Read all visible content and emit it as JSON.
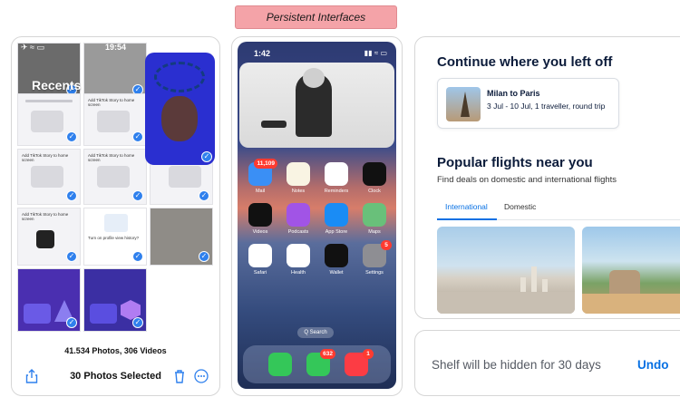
{
  "banner": {
    "title": "Persistent Interfaces"
  },
  "photos_panel": {
    "status": {
      "left": "✈ ≈ ▭",
      "time": "19:54",
      "right": "◉ 16% ▭"
    },
    "album_title": "Recents",
    "counts": "41.534 Photos, 306 Videos",
    "selected_label": "30 Photos Selected",
    "thumb_texts": {
      "add_tiktok": "Add TikTok Story to home screen",
      "profile_history": "Turn on profile view history?"
    }
  },
  "home_panel": {
    "time": "1:42",
    "status_right": "▮▮ ≈ ▭",
    "apps": [
      {
        "label": "Mail",
        "badge": "11,109",
        "color": "#3a8ff5"
      },
      {
        "label": "Notes",
        "badge": "",
        "color": "#f9f4e3"
      },
      {
        "label": "Reminders",
        "badge": "",
        "color": "#ffffff"
      },
      {
        "label": "Clock",
        "badge": "",
        "color": "#111111"
      },
      {
        "label": "Videos",
        "badge": "",
        "color": "#111111"
      },
      {
        "label": "Podcasts",
        "badge": "",
        "color": "#a154e6"
      },
      {
        "label": "App Store",
        "badge": "",
        "color": "#1a8cf5"
      },
      {
        "label": "Maps",
        "badge": "",
        "color": "#69c07a"
      },
      {
        "label": "Safari",
        "badge": "",
        "color": "#ffffff"
      },
      {
        "label": "Health",
        "badge": "",
        "color": "#ffffff"
      },
      {
        "label": "Wallet",
        "badge": "",
        "color": "#111111"
      },
      {
        "label": "Settings",
        "badge": "5",
        "color": "#8e8e93"
      }
    ],
    "search_label": "Q Search",
    "dock": [
      {
        "name": "phone",
        "badge": "",
        "color": "#34c759"
      },
      {
        "name": "messages",
        "badge": "632",
        "color": "#34c759"
      },
      {
        "name": "music",
        "badge": "1",
        "color": "#fc3c44"
      }
    ]
  },
  "flights_panel": {
    "continue_title": "Continue where you left off",
    "trip_title": "Milan to Paris",
    "trip_details": "3 Jul - 10 Jul, 1 traveller, round trip",
    "popular_title": "Popular flights near you",
    "popular_subtitle": "Find deals on domestic and international flights",
    "tabs": [
      "International",
      "Domestic"
    ],
    "active_tab": "International"
  },
  "undo_panel": {
    "message": "Shelf will be hidden for 30 days",
    "undo_label": "Undo"
  },
  "colors": {
    "accent": "#0770e3",
    "badge": "#ff3b30",
    "banner": "#f4a3a8",
    "selection": "#2f80ed"
  }
}
